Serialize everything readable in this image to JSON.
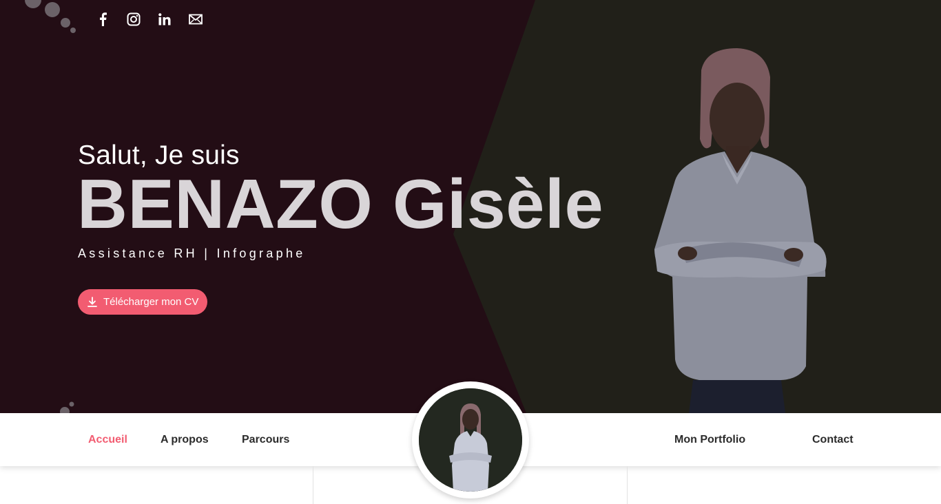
{
  "social": {
    "items": [
      {
        "name": "facebook-icon",
        "label": "f"
      },
      {
        "name": "instagram-icon"
      },
      {
        "name": "linkedin-icon",
        "label": "in"
      },
      {
        "name": "mail-icon"
      }
    ]
  },
  "hero": {
    "greeting": "Salut, Je suis",
    "name": "BENAZO Gisèle",
    "role": "Assistance RH | Infographe",
    "cv_button": "Télécharger mon CV"
  },
  "nav": {
    "home": "Accueil",
    "about": "A propos",
    "journey": "Parcours",
    "portfolio": "Mon Portfolio",
    "contact": "Contact"
  },
  "colors": {
    "accent": "#f25c71",
    "hero_left": "#230d15",
    "hero_right": "#212019"
  }
}
